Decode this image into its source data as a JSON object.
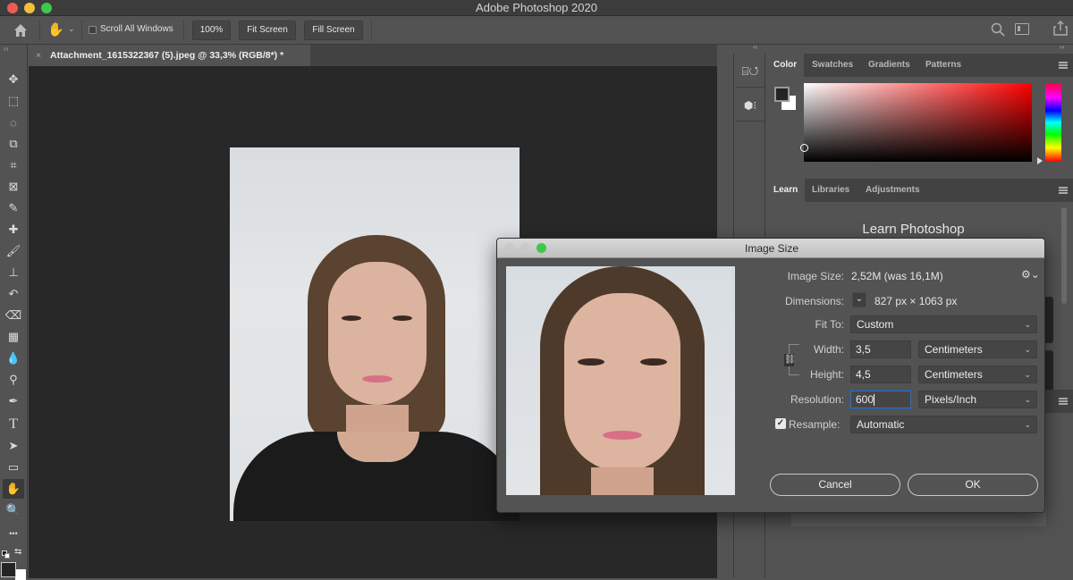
{
  "window": {
    "title": "Adobe Photoshop 2020",
    "traffic_colors": {
      "close": "#ee5b55",
      "minimize": "#f5bd3c",
      "maximize": "#3ec84a"
    }
  },
  "options_bar": {
    "home_icon": "home-icon",
    "tool_icon": "hand-icon",
    "scroll_all_windows": {
      "label": "Scroll All Windows",
      "checked": false
    },
    "buttons": [
      "100%",
      "Fit Screen",
      "Fill Screen"
    ],
    "right_icons": [
      "search-icon",
      "workspace-icon",
      "share-icon"
    ]
  },
  "document": {
    "tab_label": "Attachment_1615322367 (5).jpeg @ 33,3% (RGB/8*) *"
  },
  "tools": [
    {
      "name": "move-tool",
      "glyph": "✥"
    },
    {
      "name": "marquee-tool",
      "glyph": "⬚"
    },
    {
      "name": "lasso-tool",
      "glyph": "◌"
    },
    {
      "name": "quick-select-tool",
      "glyph": "⧉"
    },
    {
      "name": "crop-tool",
      "glyph": "⌗"
    },
    {
      "name": "frame-tool",
      "glyph": "⊠"
    },
    {
      "name": "eyedropper-tool",
      "glyph": "✎"
    },
    {
      "name": "healing-tool",
      "glyph": "✚"
    },
    {
      "name": "brush-tool",
      "glyph": "🖌"
    },
    {
      "name": "stamp-tool",
      "glyph": "⊥"
    },
    {
      "name": "history-brush-tool",
      "glyph": "↶"
    },
    {
      "name": "eraser-tool",
      "glyph": "⌫"
    },
    {
      "name": "gradient-tool",
      "glyph": "▦"
    },
    {
      "name": "blur-tool",
      "glyph": "💧"
    },
    {
      "name": "dodge-tool",
      "glyph": "⚲"
    },
    {
      "name": "pen-tool",
      "glyph": "✒"
    },
    {
      "name": "type-tool",
      "glyph": "T"
    },
    {
      "name": "path-select-tool",
      "glyph": "➤"
    },
    {
      "name": "rectangle-tool",
      "glyph": "▭"
    },
    {
      "name": "hand-tool",
      "glyph": "✋",
      "active": true
    },
    {
      "name": "zoom-tool",
      "glyph": "🔍"
    },
    {
      "name": "more-tools",
      "glyph": "•••"
    }
  ],
  "color_panel": {
    "tabs": [
      "Color",
      "Swatches",
      "Gradients",
      "Patterns"
    ],
    "active_tab": "Color",
    "foreground": "#242424",
    "background": "#ffffff",
    "hue_color": "#ff0000"
  },
  "learn_panel": {
    "tabs": [
      "Learn",
      "Libraries",
      "Adjustments"
    ],
    "active_tab": "Learn",
    "heading": "Learn Photoshop"
  },
  "image_size_dialog": {
    "title": "Image Size",
    "image_size_label": "Image Size:",
    "image_size_value": "2,52M (was 16,1M)",
    "dimensions_label": "Dimensions:",
    "dimensions_value": "827 px  ×  1063 px",
    "fit_to_label": "Fit To:",
    "fit_to_value": "Custom",
    "width_label": "Width:",
    "width_value": "3,5",
    "width_unit": "Centimeters",
    "height_label": "Height:",
    "height_value": "4,5",
    "height_unit": "Centimeters",
    "resolution_label": "Resolution:",
    "resolution_value": "600",
    "resolution_unit": "Pixels/Inch",
    "resample_label": "Resample:",
    "resample_checked": true,
    "resample_value": "Automatic",
    "cancel_label": "Cancel",
    "ok_label": "OK"
  }
}
